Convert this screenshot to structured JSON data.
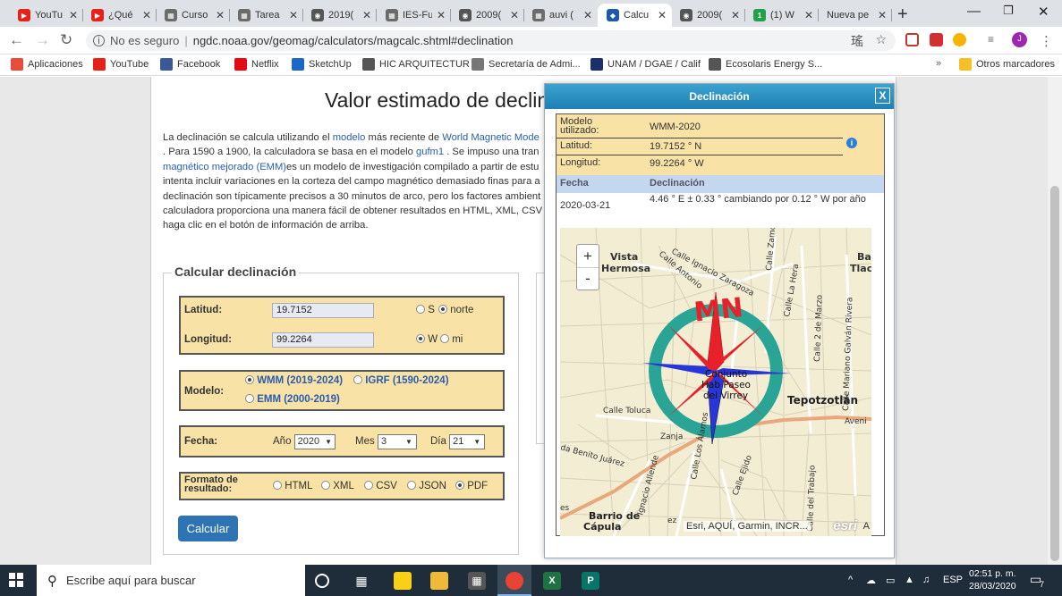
{
  "browser": {
    "tabs": [
      {
        "title": "YouTu",
        "fav_color": "#e62117",
        "fav_glyph": "▶"
      },
      {
        "title": "¿Qué",
        "fav_color": "#e62117",
        "fav_glyph": "▶"
      },
      {
        "title": "Curso",
        "fav_color": "#6b6b6b",
        "fav_glyph": "▦"
      },
      {
        "title": "Tarea",
        "fav_color": "#6b6b6b",
        "fav_glyph": "▦"
      },
      {
        "title": "2019(",
        "fav_color": "#555555",
        "fav_glyph": "◉"
      },
      {
        "title": "IES-Fu",
        "fav_color": "#6b6b6b",
        "fav_glyph": "▦"
      },
      {
        "title": "2009(",
        "fav_color": "#555555",
        "fav_glyph": "◉"
      },
      {
        "title": "auvi (",
        "fav_color": "#6b6b6b",
        "fav_glyph": "▦"
      },
      {
        "title": "Calcu",
        "fav_color": "#1e5aa8",
        "fav_glyph": "◆"
      },
      {
        "title": "2009(",
        "fav_color": "#555555",
        "fav_glyph": "◉"
      },
      {
        "title": "(1) W",
        "fav_color": "#22a04b",
        "fav_glyph": "1"
      },
      {
        "title": "Nueva pe",
        "fav_color": "",
        "fav_glyph": ""
      }
    ],
    "active_tab_index": 8,
    "security_label": "No es seguro",
    "url": "ngdc.noaa.gov/geomag/calculators/magcalc.shtml#declination",
    "profile_initial": "J"
  },
  "bookmarks": [
    {
      "label": "Aplicaciones",
      "icon": "apps-grid-icon",
      "color": "#e74c3c"
    },
    {
      "label": "YouTube",
      "icon": "youtube-icon",
      "color": "#e62117"
    },
    {
      "label": "Facebook",
      "icon": "facebook-icon",
      "color": "#3b5998"
    },
    {
      "label": "Netflix",
      "icon": "netflix-icon",
      "color": "#e50914"
    },
    {
      "label": "SketchUp",
      "icon": "sketchup-icon",
      "color": "#1b66c9"
    },
    {
      "label": "HIC ARQUITECTUR",
      "icon": "globe-icon",
      "color": "#555555"
    },
    {
      "label": "Secretaría de Admi...",
      "icon": "speaker-icon",
      "color": "#777777"
    },
    {
      "label": "UNAM / DGAE / Calif",
      "icon": "unam-icon",
      "color": "#1a2f6b"
    },
    {
      "label": "Ecosolaris Energy S...",
      "icon": "globe-icon",
      "color": "#555555"
    }
  ],
  "other_bookmarks": "Otros marcadores",
  "page": {
    "title": "Valor estimado de declin",
    "intro_lines": [
      [
        "La declinación se calcula utilizando el ",
        "modelo",
        " más reciente de ",
        "World Magnetic Mode"
      ],
      [
        ". Para 1590 a 1900, la calculadora se basa en el modelo ",
        "gufm1",
        " . Se impuso una tran"
      ],
      [
        "magnético mejorado (EMM)",
        "es un modelo de investigación compilado a partir de estu"
      ],
      [
        "intenta incluir variaciones en la corteza del campo magnético demasiado finas para a"
      ],
      [
        "declinación son típicamente precisos a 30 minutos de arco, pero los factores ambient"
      ],
      [
        "calculadora proporciona una manera fácil de obtener resultados en HTML, XML, CSV"
      ],
      [
        "haga clic en el botón de información de arriba."
      ]
    ],
    "form": {
      "legend": "Calcular declinación",
      "lat_label": "Latitud:",
      "lat_value": "19.7152",
      "lat_s": "S",
      "lat_n": "norte",
      "lon_label": "Longitud:",
      "lon_value": "99.2264",
      "lon_w": "W",
      "lon_e": "mi",
      "model_label": "Modelo:",
      "model_wmm": "WMM (2019-2024)",
      "model_igrf": "IGRF (1590-2024)",
      "model_emm": "EMM (2000-2019)",
      "date_label": "Fecha:",
      "year_label": "Año",
      "year_value": "2020",
      "month_label": "Mes",
      "month_value": "3",
      "day_label": "Día",
      "day_value": "21",
      "format_label_1": "Formato de",
      "format_label_2": "resultado:",
      "formats": [
        "HTML",
        "XML",
        "CSV",
        "JSON",
        "PDF"
      ],
      "selected_format": "PDF",
      "submit": "Calcular"
    }
  },
  "popup": {
    "title": "Declinación",
    "close": "X",
    "model_key_1": "Modelo",
    "model_key_2": "utilizado:",
    "model_value": "WMM-2020",
    "lat_key": "Latitud:",
    "lat_value": "19.7152 ° N",
    "lon_key": "Longitud:",
    "lon_value": "99.2264 ° W",
    "col_date": "Fecha",
    "col_decl": "Declinación",
    "row_date": "2020-03-21",
    "row_decl": "4.46 ° E ± 0.33 ° cambiando por 0.12 ° W por año",
    "map": {
      "zoom_in": "+",
      "zoom_out": "-",
      "labels": {
        "vista": "Vista",
        "hermosa": "Hermosa",
        "ba": "Ba",
        "tlac": "Tlac",
        "zaragoza": "Calle Ignacio Zaragoza",
        "antonio": "Calle Antonio",
        "zamo": "Calle Zamo",
        "hera": "Calle La Hera",
        "marzo": "Calle 2 de Marzo",
        "galvan": "Calle Mariano Galván Rivera",
        "conjunto_1": "Conjunto",
        "conjunto_2": "Hab Paseo",
        "conjunto_3": "del Virrey",
        "tepotzotlan": "Tepotzotlán",
        "avenida": "Aveni",
        "toluca": "Calle Toluca",
        "zanja": "Zanja",
        "benito": "da Benito Juárez",
        "alamos": "Calle Los Álamos",
        "ejido": "Calle Ejido",
        "trabajo": "Calle del Trabajo",
        "allende": "Calle Allende",
        "barrio_1": "Barrio de",
        "barrio_2": "Cápula",
        "ignacio": "Ignacio Allende",
        "es": "es",
        "ez": "ez"
      },
      "compass_letters": "MN",
      "attribution": "Esri, AQUÍ, Garmin, INCR...",
      "logo": "esri",
      "after_logo": "A"
    }
  },
  "taskbar": {
    "search_placeholder": "Escribe aquí para buscar",
    "language": "ESP",
    "time": "02:51 p. m.",
    "date": "28/03/2020",
    "notifications": "7"
  },
  "colors": {
    "accent_blue": "#2e74b5",
    "form_bg": "#f9e2a6",
    "header_blue": "#1e7fb3",
    "compass_ring": "#2aa595",
    "compass_red": "#e8202a",
    "compass_blue": "#2836d8"
  }
}
